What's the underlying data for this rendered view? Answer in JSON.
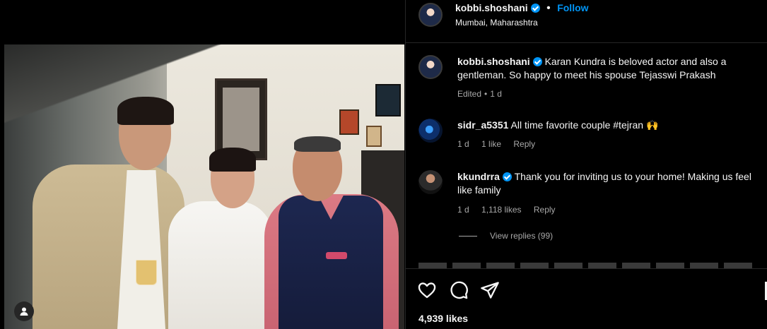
{
  "post": {
    "author": "kobbi.shoshani",
    "follow_label": "Follow",
    "location": "Mumbai, Maharashtra"
  },
  "caption": {
    "username": "kobbi.shoshani",
    "text": "Karan Kundra is beloved actor and also a gentleman. So happy to meet his spouse Tejasswi Prakash",
    "edited": "Edited",
    "time": "1 d"
  },
  "comments": [
    {
      "username": "sidr_a5351",
      "text": "All time favorite couple #tejran 🙌",
      "time": "1 d",
      "likes": "1 like",
      "reply": "Reply"
    },
    {
      "username": "kkundrra",
      "text": "Thank you for inviting us to your home! Making us feel like family",
      "time": "1 d",
      "likes": "1,118 likes",
      "reply": "Reply",
      "view_replies": "View replies (99)"
    }
  ],
  "actions": {
    "likes": "4,939 likes"
  },
  "icons": {
    "verified": "verified-badge-icon",
    "like": "heart-icon",
    "comment": "comment-icon",
    "share": "share-icon",
    "save": "save-icon",
    "tag": "user-tag-icon"
  },
  "colors": {
    "background": "#000000",
    "accent": "#0095f6",
    "muted": "#a8a8a8"
  }
}
